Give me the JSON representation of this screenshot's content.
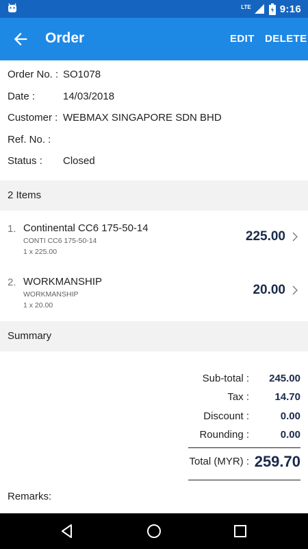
{
  "status_bar": {
    "time": "9:16",
    "network": "LTE",
    "icons": [
      "android-icon",
      "signal-icon",
      "battery-icon"
    ]
  },
  "app_bar": {
    "title": "Order",
    "edit_label": "EDIT",
    "delete_label": "DELETE"
  },
  "order": {
    "order_no_label": "Order No. :",
    "order_no": "SO1078",
    "date_label": "Date :",
    "date": "14/03/2018",
    "customer_label": "Customer :",
    "customer": "WEBMAX SINGAPORE SDN BHD",
    "ref_label": "Ref. No. :",
    "ref": "",
    "status_label": "Status :",
    "status": "Closed"
  },
  "items_header": "2 Items",
  "items": [
    {
      "num": "1.",
      "name": "Continental CC6 175-50-14",
      "sub": "CONTI CC6 175-50-14",
      "qty": "1 x 225.00",
      "amount": "225.00"
    },
    {
      "num": "2.",
      "name": "WORKMANSHIP",
      "sub": "WORKMANSHIP",
      "qty": "1 x 20.00",
      "amount": "20.00"
    }
  ],
  "summary_header": "Summary",
  "summary": {
    "subtotal_label": "Sub-total :",
    "subtotal": "245.00",
    "tax_label": "Tax :",
    "tax": "14.70",
    "discount_label": "Discount :",
    "discount": "0.00",
    "rounding_label": "Rounding :",
    "rounding": "0.00",
    "total_label": "Total (MYR) :",
    "total": "259.70"
  },
  "remarks_label": "Remarks:",
  "colors": {
    "status_bar": "#1565c0",
    "app_bar": "#1e88e5",
    "amount": "#1a2a4a",
    "section_bg": "#f2f2f2"
  }
}
